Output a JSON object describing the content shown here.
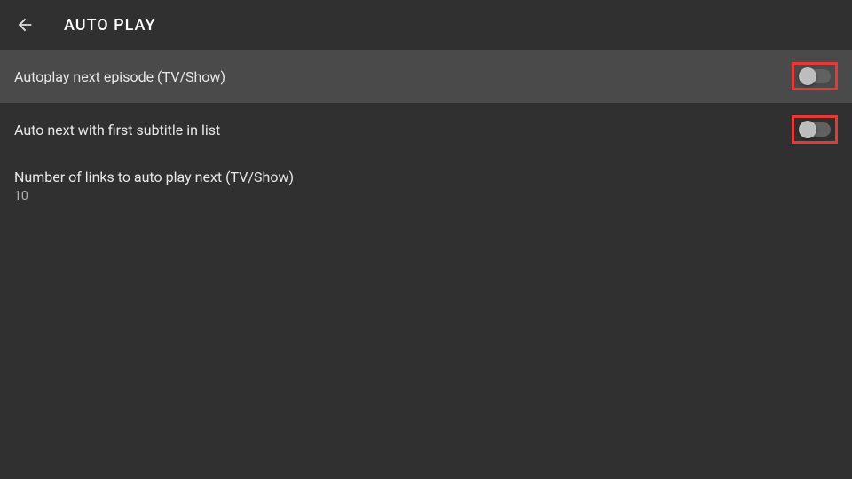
{
  "header": {
    "title": "AUTO PLAY"
  },
  "settings": {
    "items": [
      {
        "label": "Autoplay next episode (TV/Show)",
        "toggle": "off",
        "highlighted": true,
        "selected": true
      },
      {
        "label": "Auto next with first subtitle in list",
        "toggle": "off",
        "highlighted": true,
        "selected": false
      },
      {
        "label": "Number of links to auto play next (TV/Show)",
        "value": "10",
        "selected": false
      }
    ]
  }
}
